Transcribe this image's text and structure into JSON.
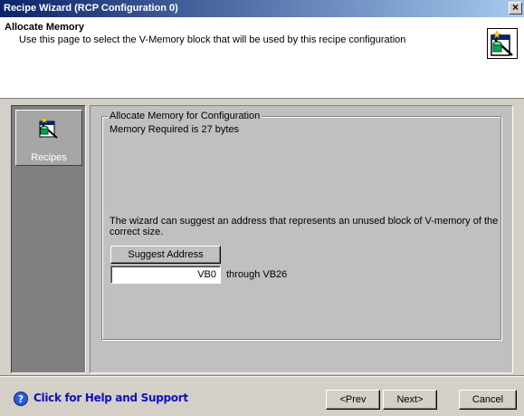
{
  "window": {
    "title": "Recipe Wizard (RCP Configuration 0)",
    "close_glyph": "×"
  },
  "header": {
    "title": "Allocate Memory",
    "description": "Use this page to select the V-Memory block that will be used by this recipe configuration",
    "icon": "recipe-wizard-icon"
  },
  "sidebar": {
    "items": [
      {
        "label": "Recipes",
        "icon": "recipe-icon"
      }
    ]
  },
  "content": {
    "group_title": "Allocate Memory for Configuration",
    "memory_required": "Memory Required is 27 bytes",
    "suggest_text": "The wizard can suggest an address that represents an unused block of V-memory of the correct size.",
    "suggest_button": "Suggest Address",
    "address_value": "VB0",
    "through_text": "through VB26"
  },
  "footer": {
    "help_text": "Click for Help and Support",
    "help_icon": "help-icon",
    "prev_label": "<Prev",
    "next_label": "Next>",
    "cancel_label": "Cancel"
  },
  "colors": {
    "title_start": "#0a246a",
    "title_end": "#a6caf0",
    "sidebar": "#808080",
    "help_link": "#1010c0"
  }
}
